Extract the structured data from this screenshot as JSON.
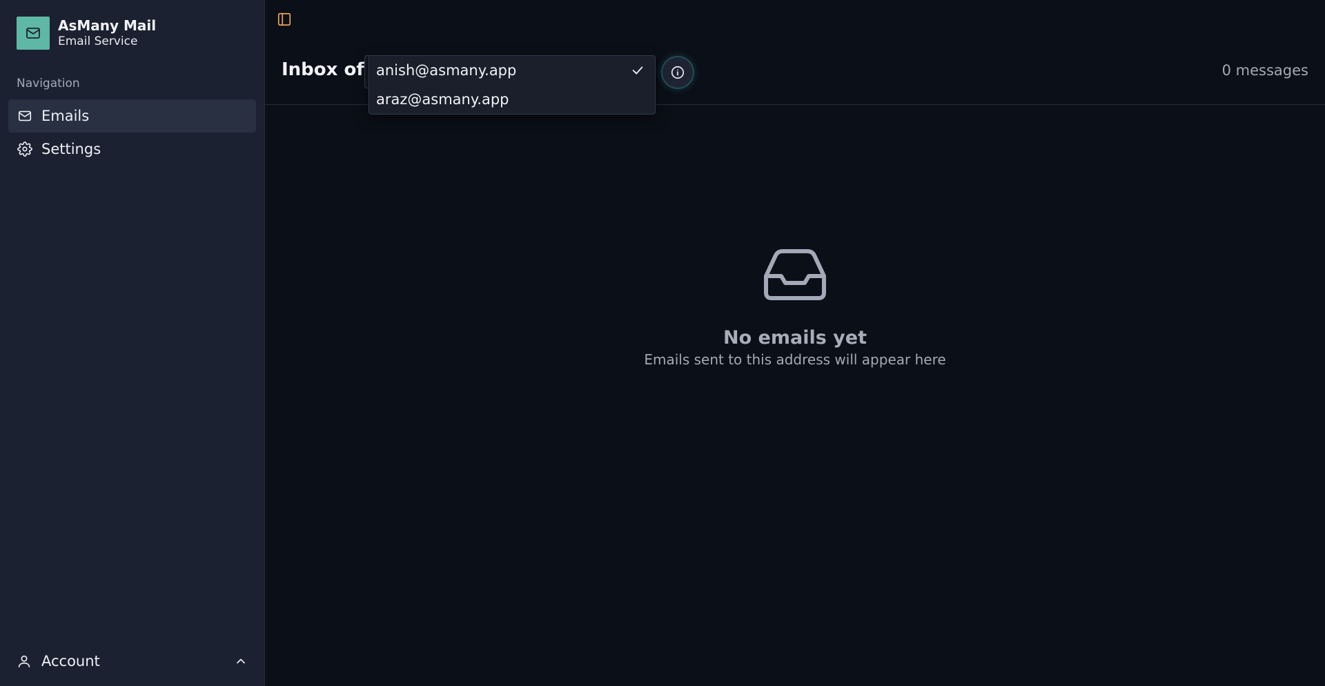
{
  "brand": {
    "name": "AsMany Mail",
    "subtitle": "Email Service"
  },
  "sidebar": {
    "heading": "Navigation",
    "items": [
      {
        "label": "Emails",
        "icon": "mail-icon",
        "active": true
      },
      {
        "label": "Settings",
        "icon": "gear-icon",
        "active": false
      }
    ],
    "account_label": "Account"
  },
  "header": {
    "title": "Inbox of",
    "message_count": "0 messages",
    "dropdown": {
      "options": [
        "anish@asmany.app",
        "araz@asmany.app"
      ],
      "selected": "anish@asmany.app"
    }
  },
  "empty": {
    "title": "No emails yet",
    "subtitle": "Emails sent to this address will appear here"
  },
  "colors": {
    "accent": "#5fb8a6",
    "toggle_icon": "#f0a860",
    "sidebar_bg": "#1b2130",
    "main_bg": "#0b0f17"
  }
}
